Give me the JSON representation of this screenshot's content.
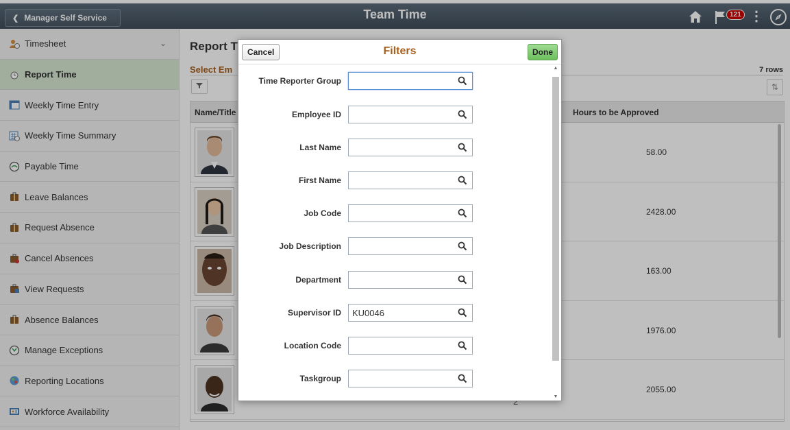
{
  "header": {
    "back_label": "Manager Self Service",
    "title": "Team Time",
    "notification_count": "121"
  },
  "sidebar": {
    "items": [
      {
        "label": "Timesheet",
        "icon": "timesheet-icon"
      },
      {
        "label": "Report Time",
        "icon": "report-time-icon"
      },
      {
        "label": "Weekly Time Entry",
        "icon": "weekly-entry-icon"
      },
      {
        "label": "Weekly Time Summary",
        "icon": "weekly-summary-icon"
      },
      {
        "label": "Payable Time",
        "icon": "payable-time-icon"
      },
      {
        "label": "Leave Balances",
        "icon": "leave-balances-icon"
      },
      {
        "label": "Request Absence",
        "icon": "request-absence-icon"
      },
      {
        "label": "Cancel Absences",
        "icon": "cancel-absences-icon"
      },
      {
        "label": "View Requests",
        "icon": "view-requests-icon"
      },
      {
        "label": "Absence Balances",
        "icon": "absence-balances-icon"
      },
      {
        "label": "Manage Exceptions",
        "icon": "manage-exceptions-icon"
      },
      {
        "label": "Reporting Locations",
        "icon": "reporting-locations-icon"
      },
      {
        "label": "Workforce Availability",
        "icon": "workforce-availability-icon"
      }
    ]
  },
  "main": {
    "page_title": "Report T",
    "select_label": "Select Em",
    "rows_count": "7 rows",
    "columns": {
      "name": "Name/Title",
      "hours": "Hours to be Approved"
    },
    "rows": [
      {
        "hours": "58.00"
      },
      {
        "hours": "2428.00"
      },
      {
        "hours": "163.00"
      },
      {
        "hours": "1976.00"
      },
      {
        "hours": "2055.00"
      }
    ],
    "footer_number": "2"
  },
  "modal": {
    "title": "Filters",
    "cancel_label": "Cancel",
    "done_label": "Done",
    "fields": [
      {
        "label": "Time Reporter Group",
        "value": ""
      },
      {
        "label": "Employee ID",
        "value": ""
      },
      {
        "label": "Last Name",
        "value": ""
      },
      {
        "label": "First Name",
        "value": ""
      },
      {
        "label": "Job Code",
        "value": ""
      },
      {
        "label": "Job Description",
        "value": ""
      },
      {
        "label": "Department",
        "value": ""
      },
      {
        "label": "Supervisor ID",
        "value": "KU0046"
      },
      {
        "label": "Location Code",
        "value": ""
      },
      {
        "label": "Taskgroup",
        "value": ""
      }
    ]
  },
  "colors": {
    "header_bg": "#4b5a68",
    "accent_orange": "#a65f1c",
    "active_item_bg": "#d7e8d2",
    "done_green": "#7cc86c"
  }
}
